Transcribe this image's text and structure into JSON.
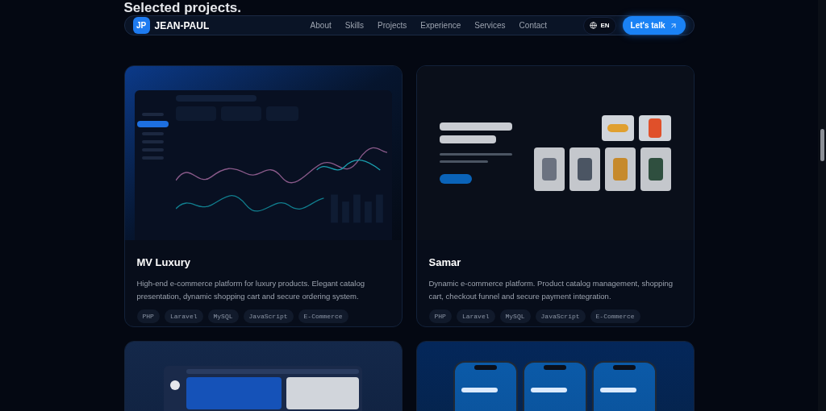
{
  "page_heading": "Selected projects.",
  "nav": {
    "logo_badge": "JP",
    "logo_text": "JEAN-PAUL",
    "links": [
      "About",
      "Skills",
      "Projects",
      "Experience",
      "Services",
      "Contact"
    ],
    "language": "EN",
    "cta": "Let's talk"
  },
  "projects": [
    {
      "kind": "dashboard",
      "title": "MV Luxury",
      "description": "High-end e-commerce platform for luxury products. Elegant catalog presentation, dynamic shopping cart and secure ordering system.",
      "tags": [
        "PHP",
        "Laravel",
        "MySQL",
        "JavaScript",
        "E-Commerce"
      ]
    },
    {
      "kind": "shop",
      "title": "Samar",
      "description": "Dynamic e-commerce platform. Product catalog management, shopping cart, checkout funnel and secure payment integration.",
      "tags": [
        "PHP",
        "Laravel",
        "MySQL",
        "JavaScript",
        "E-Commerce"
      ]
    },
    {
      "kind": "messaging"
    },
    {
      "kind": "mobile"
    }
  ]
}
